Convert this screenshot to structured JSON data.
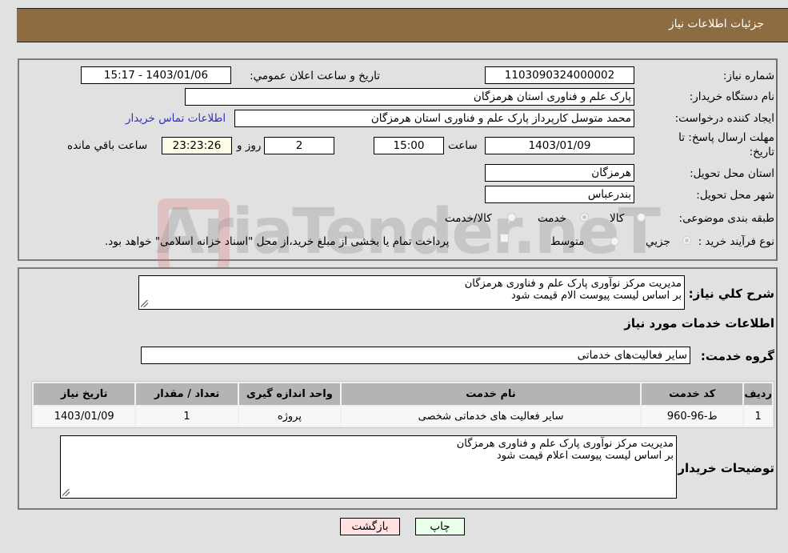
{
  "header": {
    "title": "جزئیات اطلاعات نیاز"
  },
  "details": {
    "need_number_label": "شماره نیاز:",
    "need_number": "1103090324000002",
    "announce_label": "تاریخ و ساعت اعلان عمومي:",
    "announce_value": "1403/01/06 - 15:17",
    "buyer_org_label": "نام دستگاه خریدار:",
    "buyer_org": "پارک علم و فناوری استان هرمزگان",
    "creator_label": "ایجاد کننده درخواست:",
    "creator": "محمد متوسل کارپرداز پارک علم و فناوری استان هرمزگان",
    "contact_link": "اطلاعات تماس خریدار",
    "deadline_label_1": "مهلت ارسال پاسخ: تا",
    "deadline_label_2": "تاریخ:",
    "deadline_date": "1403/01/09",
    "time_label": "ساعت",
    "deadline_time": "15:00",
    "days_value": "2",
    "days_label": "روز و",
    "remaining_time": "23:23:26",
    "remaining_label": "ساعت باقي مانده",
    "province_label": "استان محل تحویل:",
    "province": "هرمزگان",
    "city_label": "شهر محل تحویل:",
    "city": "بندرعباس",
    "category_label": "طبقه بندی موضوعی:",
    "category_options": [
      {
        "label": "کالا",
        "selected": false
      },
      {
        "label": "خدمت",
        "selected": true
      },
      {
        "label": "کالا/خدمت",
        "selected": false
      }
    ],
    "process_label": "نوع فرآیند خرید :",
    "process_options": [
      {
        "label": "جزيي",
        "selected": true
      },
      {
        "label": "متوسط",
        "selected": false
      }
    ],
    "treasury_note": "پرداخت تمام یا بخشی از مبلغ خرید،از محل \"اسناد خزانه اسلامی\" خواهد بود.",
    "treasury_checked": false
  },
  "description": {
    "label": "شرح كلي نياز:",
    "line1": "مدیریت مرکز نوآوری پارک علم و فناوری هرمزگان",
    "line2": "بر اساس لیست پیوست الام قیمت شود"
  },
  "services": {
    "section_title": "اطلاعات خدمات مورد نياز",
    "group_label": "گروه خدمت:",
    "group_value": "سایر فعالیت‌های خدماتی",
    "columns": [
      "ردیف",
      "کد خدمت",
      "نام خدمت",
      "واحد اندازه گیری",
      "تعداد / مقدار",
      "تاریخ نیاز"
    ],
    "rows": [
      [
        "1",
        "ط-96-960",
        "سایر فعالیت های خدماتی شخصی",
        "پروژه",
        "1",
        "1403/01/09"
      ]
    ]
  },
  "buyer_notes": {
    "label": "توضیحات خریدار:",
    "line1": "مدیریت مرکز نوآوری پارک علم و فناوری هرمزگان",
    "line2": "بر اساس لیست پیوست اعلام قیمت شود"
  },
  "buttons": {
    "print": "چاپ",
    "back": "بازگشت"
  },
  "watermark": "AriaTender.neT"
}
